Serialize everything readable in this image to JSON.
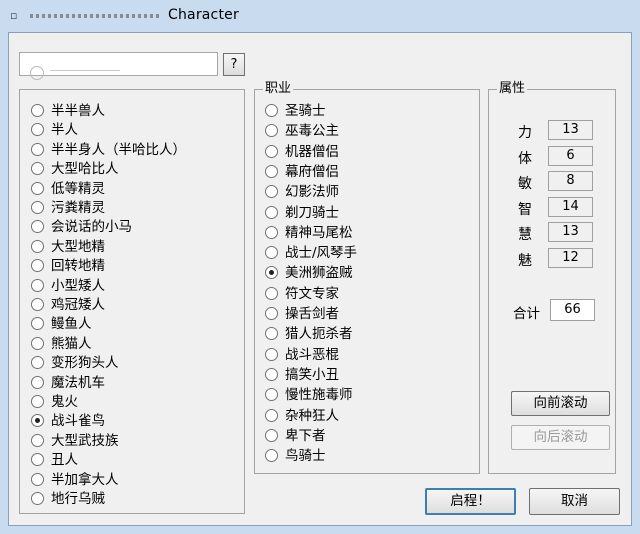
{
  "window": {
    "title": "Character"
  },
  "help_label": "?",
  "race_list": [
    {
      "label": "半半兽人",
      "checked": false
    },
    {
      "label": "半人",
      "checked": false
    },
    {
      "label": "半半身人（半哈比人）",
      "checked": false
    },
    {
      "label": "大型哈比人",
      "checked": false
    },
    {
      "label": "低等精灵",
      "checked": false
    },
    {
      "label": "污粪精灵",
      "checked": false
    },
    {
      "label": "会说话的小马",
      "checked": false
    },
    {
      "label": "大型地精",
      "checked": false
    },
    {
      "label": "回转地精",
      "checked": false
    },
    {
      "label": "小型矮人",
      "checked": false
    },
    {
      "label": "鸡冠矮人",
      "checked": false
    },
    {
      "label": "鳗鱼人",
      "checked": false
    },
    {
      "label": "熊猫人",
      "checked": false
    },
    {
      "label": "变形狗头人",
      "checked": false
    },
    {
      "label": "魔法机车",
      "checked": false
    },
    {
      "label": "鬼火",
      "checked": false
    },
    {
      "label": "战斗雀鸟",
      "checked": true
    },
    {
      "label": "大型武技族",
      "checked": false
    },
    {
      "label": "丑人",
      "checked": false
    },
    {
      "label": "半加拿大人",
      "checked": false
    },
    {
      "label": "地行乌贼",
      "checked": false
    }
  ],
  "class_group": {
    "label": "职业",
    "items": [
      {
        "label": "圣骑士",
        "checked": false
      },
      {
        "label": "巫毒公主",
        "checked": false
      },
      {
        "label": "机器僧侣",
        "checked": false
      },
      {
        "label": "幕府僧侣",
        "checked": false
      },
      {
        "label": "幻影法师",
        "checked": false
      },
      {
        "label": "剃刀骑士",
        "checked": false
      },
      {
        "label": "精神马尾松",
        "checked": false
      },
      {
        "label": "战士/风琴手",
        "checked": false
      },
      {
        "label": "美洲狮盗贼",
        "checked": true
      },
      {
        "label": "符文专家",
        "checked": false
      },
      {
        "label": "操舌剑者",
        "checked": false
      },
      {
        "label": "猎人扼杀者",
        "checked": false
      },
      {
        "label": "战斗恶棍",
        "checked": false
      },
      {
        "label": "搞笑小丑",
        "checked": false
      },
      {
        "label": "慢性施毒师",
        "checked": false
      },
      {
        "label": "杂种狂人",
        "checked": false
      },
      {
        "label": "卑下者",
        "checked": false
      },
      {
        "label": "鸟骑士",
        "checked": false
      }
    ]
  },
  "stats_group": {
    "label": "属性",
    "stats": [
      {
        "label": "力",
        "value": "13"
      },
      {
        "label": "体",
        "value": "6"
      },
      {
        "label": "敏",
        "value": "8"
      },
      {
        "label": "智",
        "value": "14"
      },
      {
        "label": "慧",
        "value": "13"
      },
      {
        "label": "魅",
        "value": "12"
      }
    ],
    "total_label": "合计",
    "total_value": "66",
    "roll_button": "向前滚动",
    "unroll_button": "向后滚动"
  },
  "footer": {
    "ok_label": "启程！",
    "cancel_label": "取消"
  },
  "colors": {
    "titlebar": "#c9dbee",
    "dialog_bg": "#f0f0f0",
    "default_button_border": "#3c7fb1"
  }
}
